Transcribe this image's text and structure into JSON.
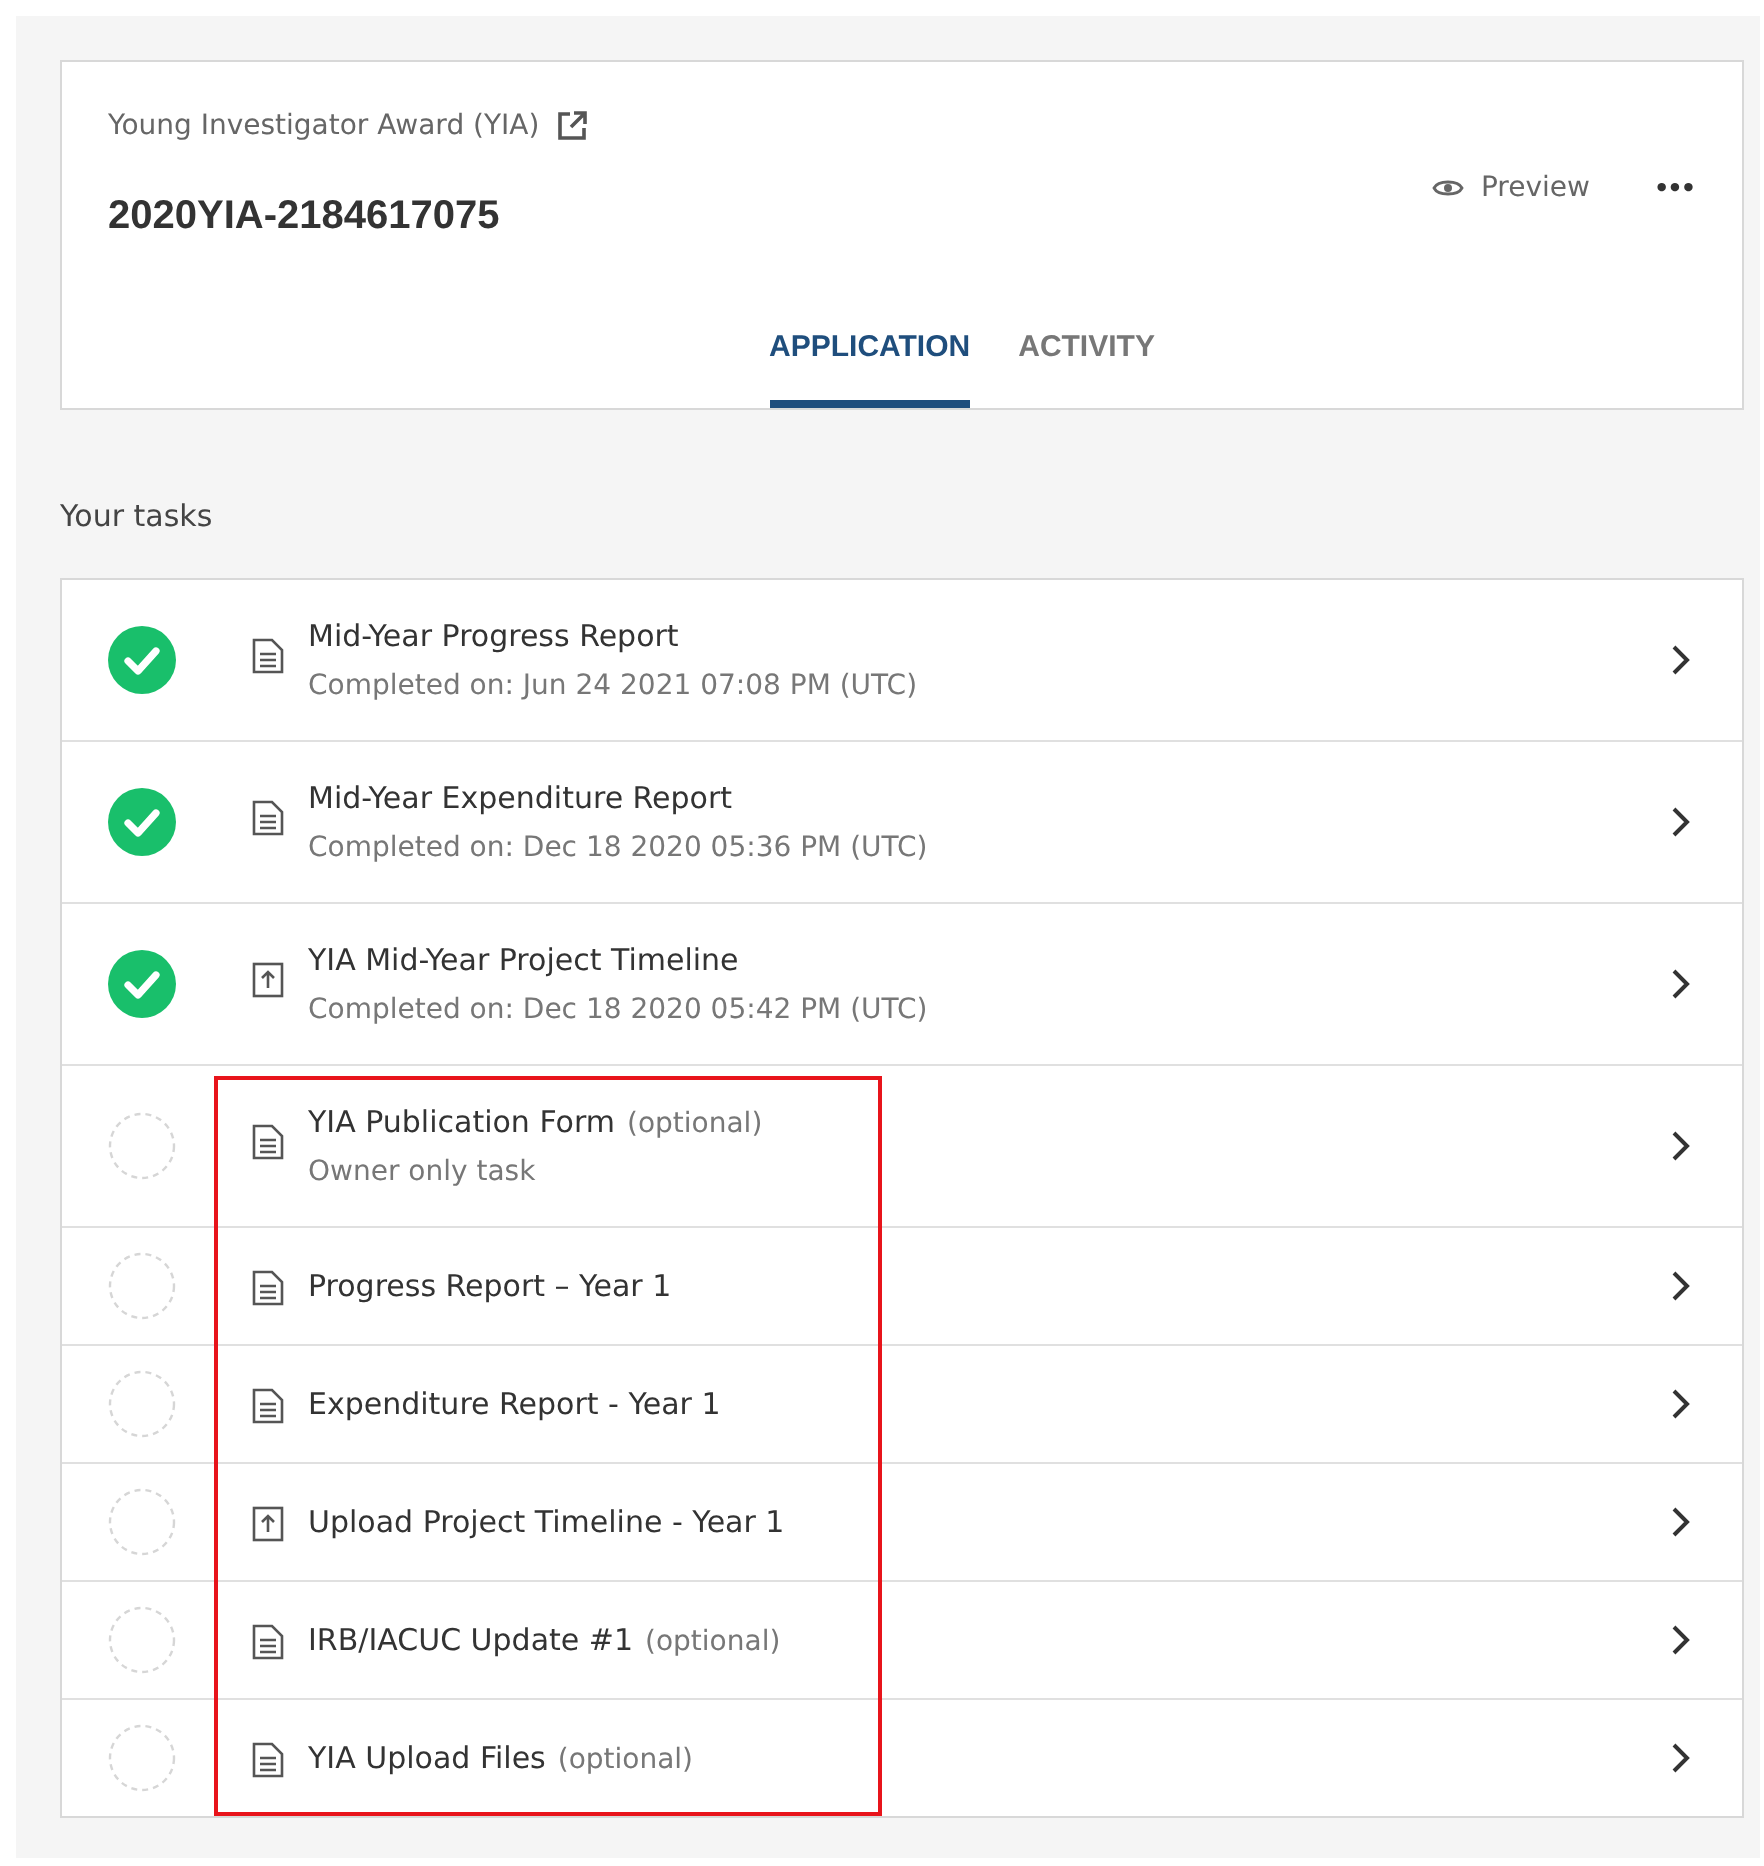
{
  "header": {
    "program": "Young Investigator Award (YIA)",
    "application_id": "2020YIA-2184617075",
    "preview": "Preview",
    "more": "•••"
  },
  "tabs": [
    {
      "label": "APPLICATION",
      "selected": true
    },
    {
      "label": "ACTIVITY",
      "selected": false
    }
  ],
  "tasks_heading": "Your tasks",
  "tasks": [
    {
      "kind": "document",
      "title": "Mid-Year Progress Report",
      "subtitle": "Completed on: Jun 24 2021 07:08 PM (UTC)",
      "completed": true,
      "highlighted": false
    },
    {
      "kind": "document",
      "title": "Mid-Year Expenditure Report",
      "subtitle": "Completed on: Dec 18 2020 05:36 PM (UTC)",
      "completed": true,
      "highlighted": false
    },
    {
      "kind": "upload",
      "title": "YIA Mid-Year Project Timeline",
      "subtitle": "Completed on: Dec 18 2020 05:42 PM (UTC)",
      "completed": true,
      "highlighted": false
    },
    {
      "kind": "document",
      "title": "YIA Publication Form",
      "note": "(optional)",
      "subtitle": "Owner only task",
      "completed": false,
      "highlighted": true
    },
    {
      "kind": "document",
      "title": "Progress Report – Year 1",
      "completed": false,
      "highlighted": true
    },
    {
      "kind": "document",
      "title": "Expenditure Report - Year 1",
      "completed": false,
      "highlighted": true
    },
    {
      "kind": "upload",
      "title": "Upload Project Timeline - Year 1",
      "completed": false,
      "highlighted": true
    },
    {
      "kind": "document",
      "title": "IRB/IACUC Update #1",
      "note": "(optional)",
      "completed": false,
      "highlighted": true
    },
    {
      "kind": "document",
      "title": "YIA Upload Files",
      "note": "(optional)",
      "completed": false,
      "highlighted": true
    }
  ]
}
